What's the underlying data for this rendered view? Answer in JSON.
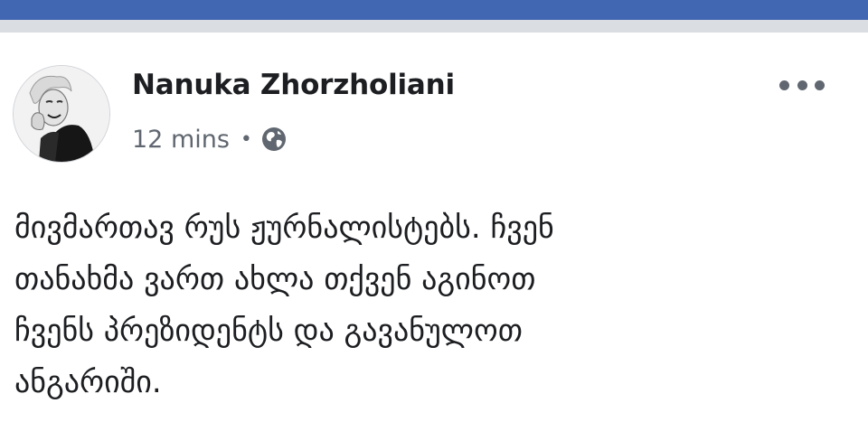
{
  "header_bar_color": "#4267b2",
  "separator_color": "#dadde1",
  "post": {
    "author_name": "Nanuka Zhorzholiani",
    "timestamp": "12 mins",
    "separator": "•",
    "audience_icon": "globe-icon",
    "more_icon": "more-options-icon",
    "avatar": "profile-photo",
    "lines": [
      "მივმართავ რუს ჟურნალისტებს. ჩვენ",
      "თანახმა ვართ  ახლა თქვენ აგინოთ",
      "ჩვენს პრეზიდენტს და გავანულოთ",
      "ანგარიში."
    ]
  }
}
